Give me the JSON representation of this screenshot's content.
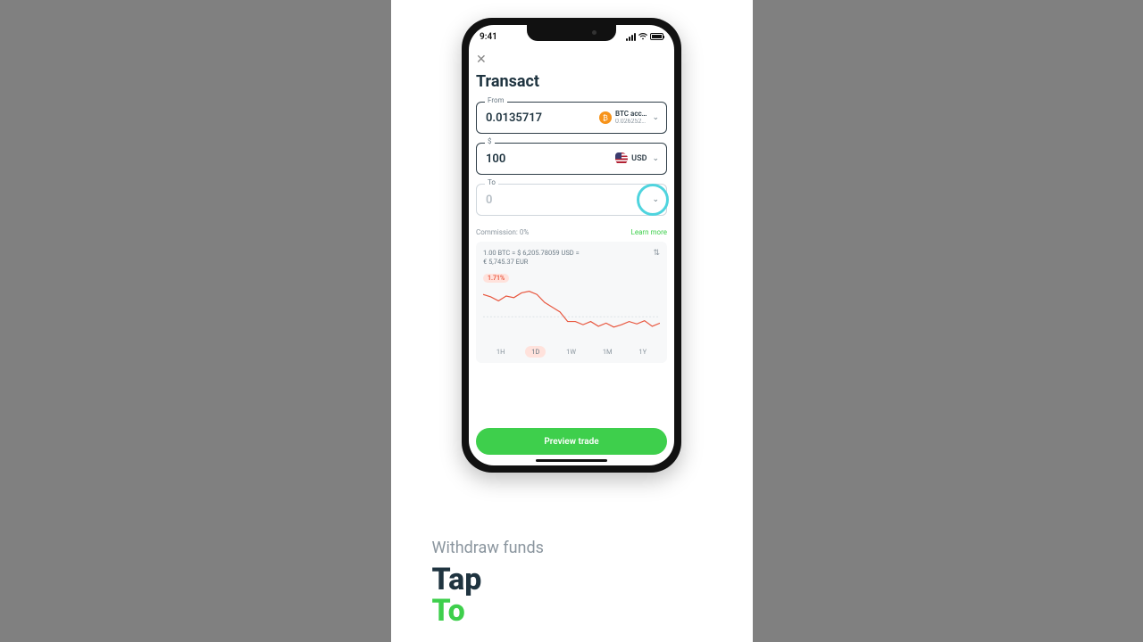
{
  "status_bar": {
    "time": "9:41"
  },
  "screen": {
    "title": "Transact",
    "close_icon": "×",
    "from": {
      "label": "From",
      "value": "0.0135717",
      "account_name": "BTC acc…",
      "account_balance": "0.026252…",
      "coin_symbol": "₿"
    },
    "amount": {
      "label": "$",
      "value": "100",
      "currency": "USD"
    },
    "to": {
      "label": "To",
      "placeholder": "0"
    },
    "commission": {
      "text": "Commission: 0%",
      "learn_more": "Learn more"
    },
    "rates": {
      "line1": "1.00 BTC = $ 6,205.78059 USD =",
      "line2": "€ 5,745.37 EUR",
      "pct": "1.71%"
    },
    "timeranges": [
      "1H",
      "1D",
      "1W",
      "1M",
      "1Y"
    ],
    "timeranges_active": 1,
    "preview_btn": "Preview trade"
  },
  "caption": {
    "subtitle": "Withdraw funds",
    "line1": "Tap",
    "line2": "To"
  },
  "chart_data": {
    "type": "line",
    "title": "",
    "xlabel": "",
    "ylabel": "",
    "ylim": [
      5700,
      6350
    ],
    "x": [
      0,
      1,
      2,
      3,
      4,
      5,
      6,
      7,
      8,
      9,
      10,
      11,
      12,
      13,
      14,
      15,
      16,
      17,
      18,
      19,
      20,
      21,
      22,
      23
    ],
    "values": [
      6280,
      6250,
      6200,
      6260,
      6240,
      6300,
      6320,
      6280,
      6180,
      6120,
      6060,
      5940,
      5940,
      5900,
      5940,
      5880,
      5920,
      5870,
      5900,
      5940,
      5910,
      5950,
      5880,
      5920
    ],
    "baseline": 6000,
    "color": "#e8573f"
  }
}
